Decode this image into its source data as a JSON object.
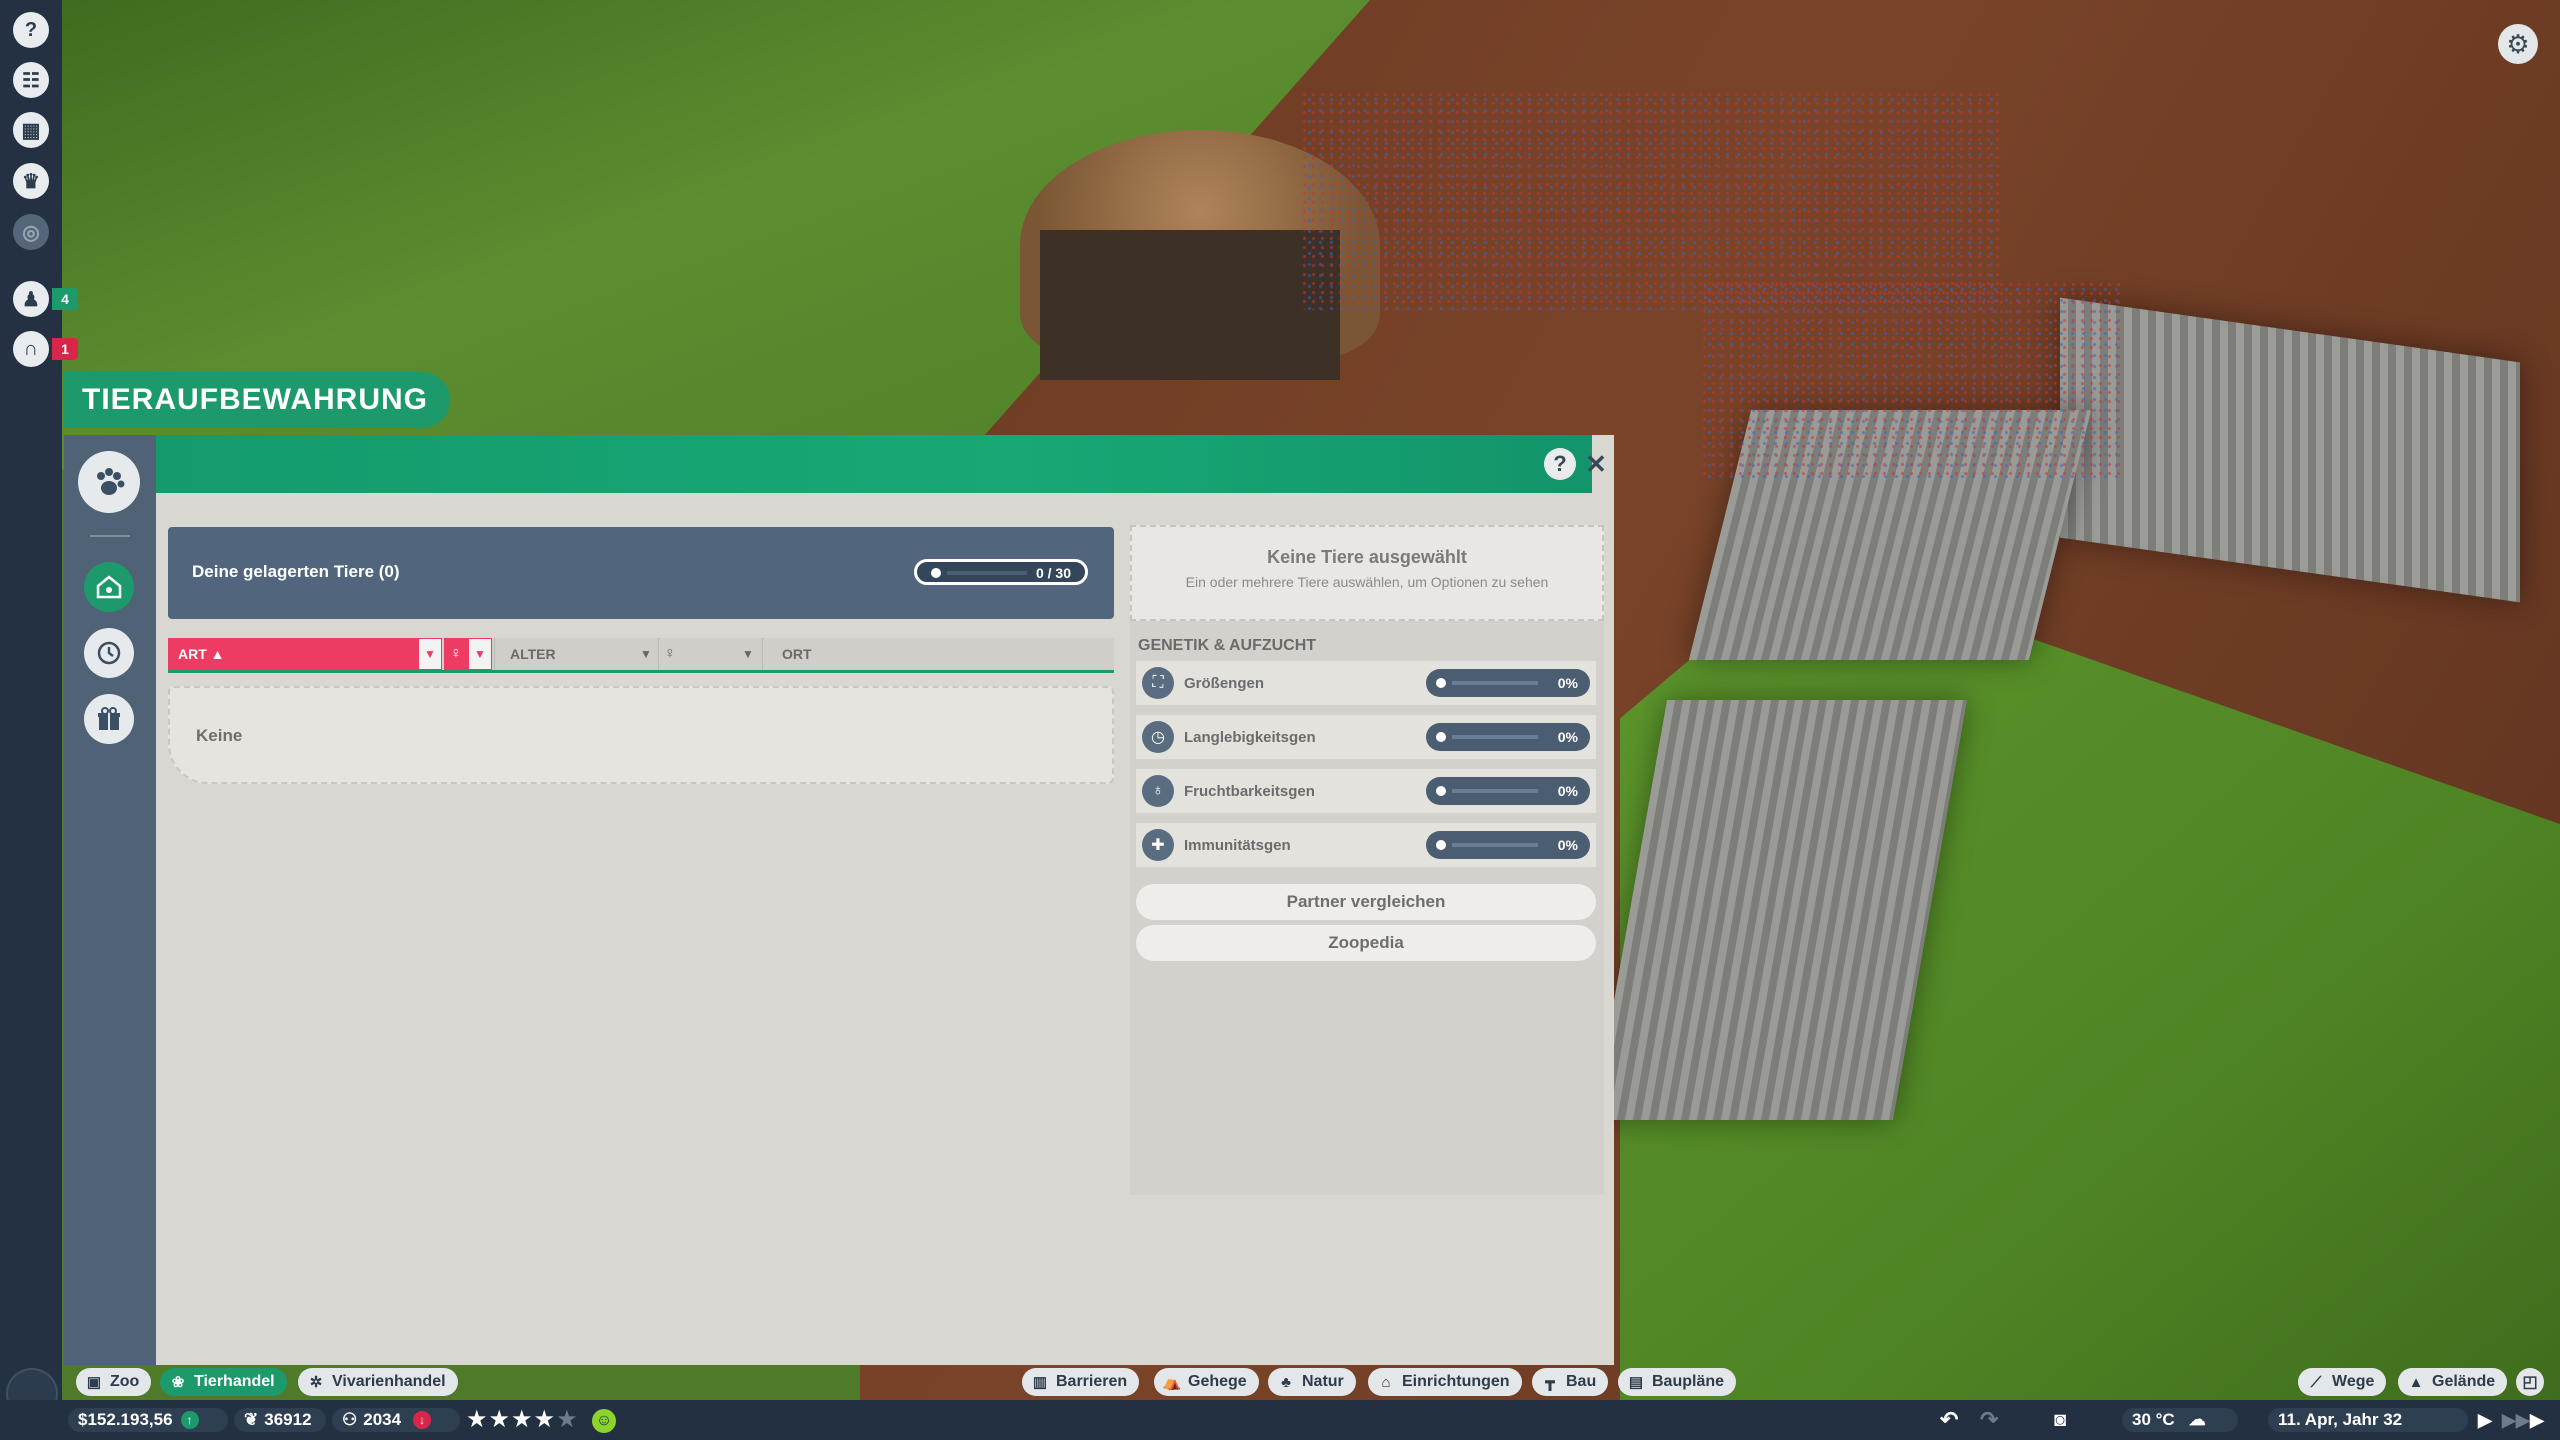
{
  "left_bar": {
    "buttons": [
      {
        "icon": "help-icon",
        "glyph": "?"
      },
      {
        "icon": "scenario-icon",
        "glyph": "☷"
      },
      {
        "icon": "calendar-icon",
        "glyph": "▦"
      },
      {
        "icon": "trophy-icon",
        "glyph": "♛"
      },
      {
        "icon": "target-icon",
        "glyph": "◎"
      },
      {
        "icon": "staff-icon",
        "glyph": "♟",
        "badge": "4",
        "badge_color": "#1c9a6c"
      },
      {
        "icon": "gate-icon",
        "glyph": "∩",
        "badge": "1",
        "badge_color": "#d8264a"
      }
    ]
  },
  "panel": {
    "title": "TIERAUFBEWAHRUNG",
    "help_glyph": "?",
    "close_glyph": "✕",
    "stored_label": "Deine gelagerten Tiere (0)",
    "capacity": "0 / 30",
    "filters": {
      "art": "ART ▲",
      "alter": "ALTER",
      "ort": "ORT"
    },
    "empty_text": "Keine",
    "selection": {
      "title": "Keine Tiere ausgewählt",
      "subtitle": "Ein oder mehrere Tiere auswählen, um Optionen zu sehen"
    },
    "genetics_title": "GENETIK & AUFZUCHT",
    "genes": [
      {
        "label": "Größengen",
        "value": "0%",
        "icon": "size-gene-icon",
        "glyph": "⛶"
      },
      {
        "label": "Langlebigkeitsgen",
        "value": "0%",
        "icon": "longevity-gene-icon",
        "glyph": "◷"
      },
      {
        "label": "Fruchtbarkeitsgen",
        "value": "0%",
        "icon": "fertility-gene-icon",
        "glyph": "♁"
      },
      {
        "label": "Immunitätsgen",
        "value": "0%",
        "icon": "immunity-gene-icon",
        "glyph": "✚"
      }
    ],
    "compare_button": "Partner vergleichen",
    "zoopedia_button": "Zoopedia"
  },
  "bottom_tabs": {
    "zoo": "Zoo",
    "tierhandel": "Tierhandel",
    "vivarienhandel": "Vivarienhandel",
    "barrieren": "Barrieren",
    "gehege": "Gehege",
    "natur": "Natur",
    "einrichtungen": "Einrichtungen",
    "bau": "Bau",
    "bauplaene": "Baupläne",
    "wege": "Wege",
    "gelaende": "Gelände"
  },
  "status": {
    "money": "$152.193,56",
    "conservation": "36912",
    "guests": "2034",
    "rating_stars": 3.5,
    "temperature": "30 °C",
    "date": "11. Apr, Jahr 32"
  },
  "colors": {
    "accent_green": "#1c9a6c",
    "filter_pink": "#ee3b64",
    "sidebar_slate": "#4f6276"
  }
}
